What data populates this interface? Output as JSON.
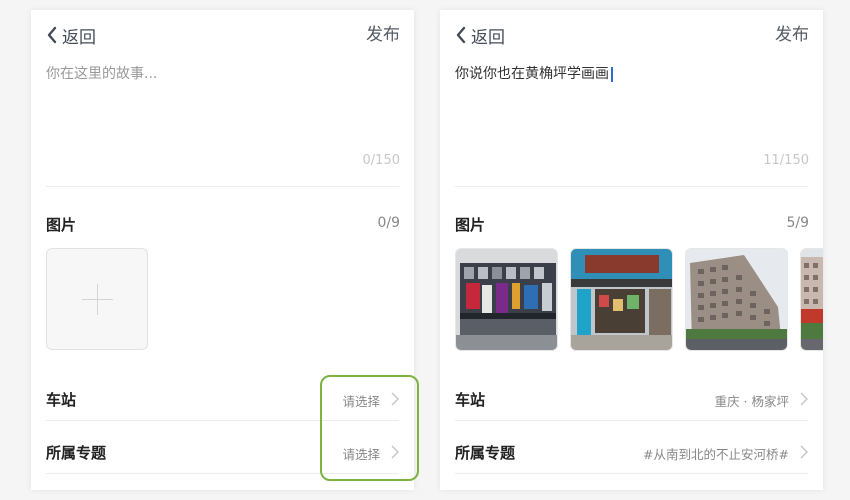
{
  "left": {
    "back_label": "返回",
    "publish_label": "发布",
    "story_placeholder": "你在这里的故事...",
    "char_counter": "0/150",
    "photos_label": "图片",
    "photos_count": "0/9",
    "station_label": "车站",
    "station_value": "请选择",
    "topic_label": "所属专题",
    "topic_value": "请选择"
  },
  "right": {
    "back_label": "返回",
    "publish_label": "发布",
    "story_text": "你说你也在黄桷坪学画画",
    "char_counter": "11/150",
    "photos_label": "图片",
    "photos_count": "5/9",
    "station_label": "车站",
    "station_value": "重庆 · 杨家坪",
    "topic_label": "所属专题",
    "topic_value": "#从南到北的不止安河桥#"
  },
  "icons": {
    "back": "chevron-left-icon",
    "add": "plus-icon",
    "row_arrow": "chevron-right-icon"
  },
  "colors": {
    "highlight_border": "#7cb342",
    "text_caret": "#2b6fd6"
  }
}
